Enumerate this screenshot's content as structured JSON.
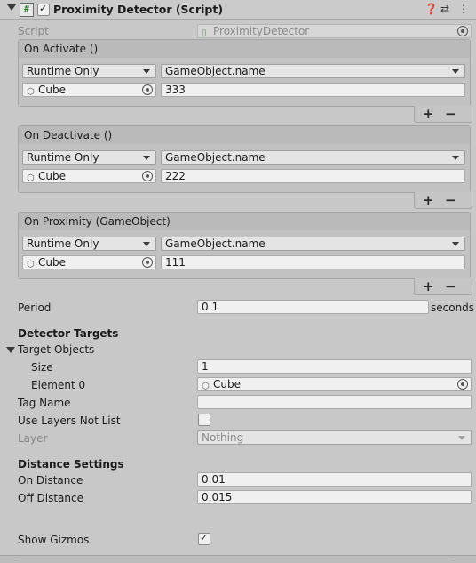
{
  "header": {
    "title": "Proximity Detector (Script)",
    "icon": "script-hash-icon",
    "enabled": true
  },
  "script": {
    "label": "Script",
    "value": "ProximityDetector"
  },
  "events": [
    {
      "title": "On Activate ()",
      "mode": "Runtime Only",
      "function": "GameObject.name",
      "object": "Cube",
      "argument": "333"
    },
    {
      "title": "On Deactivate ()",
      "mode": "Runtime Only",
      "function": "GameObject.name",
      "object": "Cube",
      "argument": "222"
    },
    {
      "title": "On Proximity (GameObject)",
      "mode": "Runtime Only",
      "function": "GameObject.name",
      "object": "Cube",
      "argument": "111"
    }
  ],
  "event_buttons": {
    "plus": "+",
    "minus": "−"
  },
  "period": {
    "label": "Period",
    "value": "0.1",
    "unit": "seconds"
  },
  "detector_targets": {
    "heading": "Detector Targets",
    "target_objects": {
      "label": "Target Objects",
      "size_label": "Size",
      "size": "1",
      "element_label": "Element 0",
      "element_value": "Cube"
    },
    "tag_name": {
      "label": "Tag Name",
      "value": ""
    },
    "use_layers": {
      "label": "Use Layers Not List",
      "checked": false
    },
    "layer": {
      "label": "Layer",
      "value": "Nothing"
    }
  },
  "distance_settings": {
    "heading": "Distance Settings",
    "on_distance": {
      "label": "On Distance",
      "value": "0.01"
    },
    "off_distance": {
      "label": "Off Distance",
      "value": "0.015"
    }
  },
  "show_gizmos": {
    "label": "Show Gizmos",
    "checked": true
  }
}
